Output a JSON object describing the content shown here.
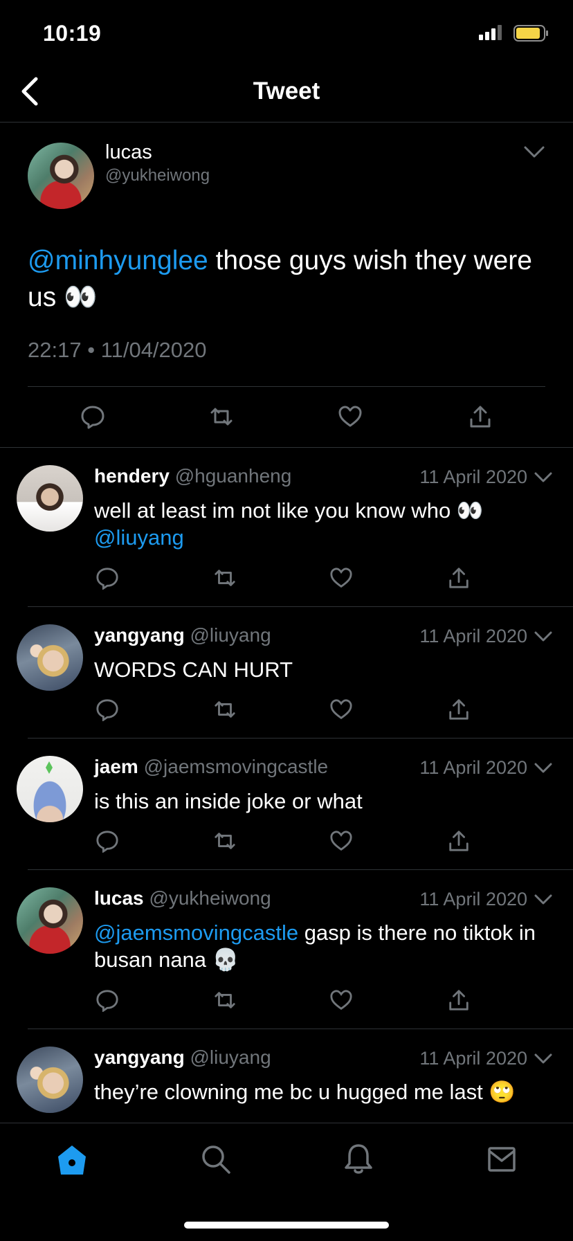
{
  "status_bar": {
    "time": "10:19"
  },
  "header": {
    "title": "Tweet"
  },
  "main_tweet": {
    "name": "lucas",
    "handle": "@yukheiwong",
    "mention": "@minhyunglee",
    "text": " those guys wish they were us 👀",
    "timestamp": "22:17 • 11/04/2020"
  },
  "replies": [
    {
      "name": "hendery",
      "handle": "@hguanheng",
      "date": "11 April 2020",
      "text_before": "well at least im not like you know who 👀 ",
      "mention": "@liuyang",
      "text_after": ""
    },
    {
      "name": "yangyang",
      "handle": "@liuyang",
      "date": "11 April 2020",
      "text_before": "WORDS CAN HURT",
      "mention": "",
      "text_after": ""
    },
    {
      "name": "jaem",
      "handle": "@jaemsmovingcastle",
      "date": "11 April 2020",
      "text_before": "is this an inside joke or what",
      "mention": "",
      "text_after": ""
    },
    {
      "name": "lucas",
      "handle": "@yukheiwong",
      "date": "11 April 2020",
      "text_before": "",
      "mention": "@jaemsmovingcastle",
      "text_after": " gasp is there no tiktok in busan nana 💀"
    },
    {
      "name": "yangyang",
      "handle": "@liuyang",
      "date": "11 April 2020",
      "text_before": "they’re clowning me bc u hugged me last 🙄",
      "mention": "",
      "text_after": ""
    }
  ],
  "tabs": [
    "home-icon",
    "search-icon",
    "bell-icon",
    "mail-icon"
  ],
  "colors": {
    "accent": "#1d9bf0",
    "muted": "#71767b",
    "divider": "#2f3336"
  }
}
